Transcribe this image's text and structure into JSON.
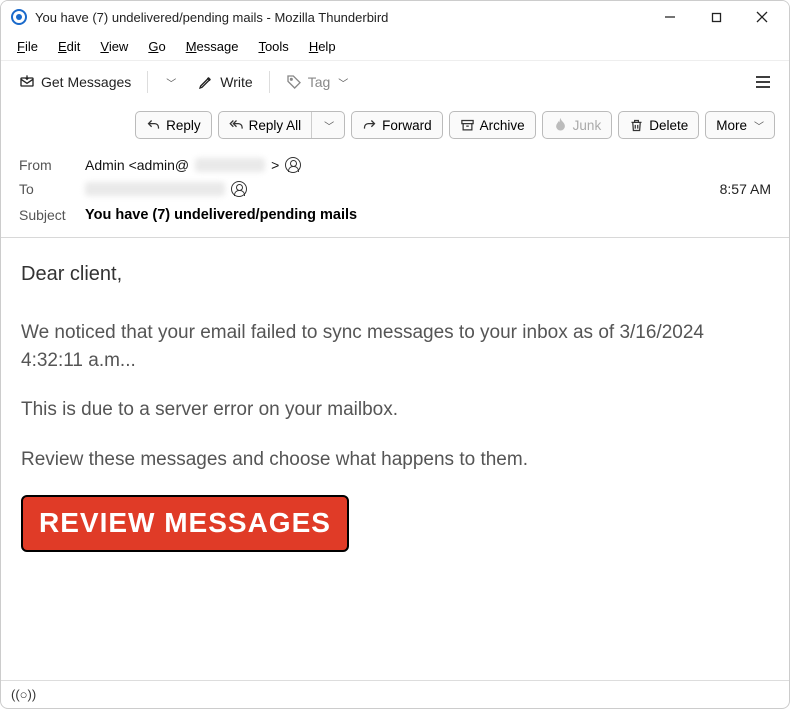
{
  "window": {
    "title": "You have (7) undelivered/pending mails - Mozilla Thunderbird"
  },
  "menubar": [
    {
      "key": "F",
      "rest": "ile"
    },
    {
      "key": "E",
      "rest": "dit"
    },
    {
      "key": "V",
      "rest": "iew"
    },
    {
      "key": "G",
      "rest": "o"
    },
    {
      "key": "M",
      "rest": "essage"
    },
    {
      "key": "T",
      "rest": "ools"
    },
    {
      "key": "H",
      "rest": "elp"
    }
  ],
  "toolbar": {
    "get_messages": "Get Messages",
    "write": "Write",
    "tag": "Tag"
  },
  "actions": {
    "reply": "Reply",
    "reply_all": "Reply All",
    "forward": "Forward",
    "archive": "Archive",
    "junk": "Junk",
    "delete": "Delete",
    "more": "More"
  },
  "headers": {
    "from_label": "From",
    "from_value_prefix": "Admin <admin@",
    "from_value_suffix": ">",
    "to_label": "To",
    "time": "8:57 AM",
    "subject_label": "Subject",
    "subject_value": "You have (7) undelivered/pending mails"
  },
  "body": {
    "greeting": "Dear client,",
    "p1": "We noticed that your email failed to sync messages to your inbox as of 3/16/2024 4:32:11 a.m...",
    "p2": "This is due to a server error on your mailbox.",
    "p3": "Review these messages and choose what happens to them.",
    "cta": "REVIEW MESSAGES"
  },
  "status": {
    "indicator": "((○))"
  }
}
